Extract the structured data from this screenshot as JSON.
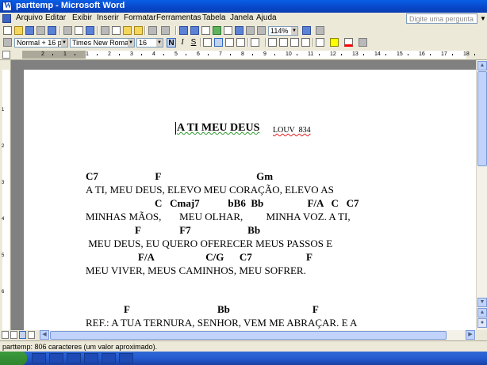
{
  "window": {
    "title": "parttemp - Microsoft Word"
  },
  "menubar": {
    "items": [
      "Arquivo",
      "Editar",
      "Exibir",
      "Inserir",
      "Formatar",
      "Ferramentas",
      "Tabela",
      "Janela",
      "Ajuda"
    ],
    "help_placeholder": "Digite uma pergunta"
  },
  "standard_toolbar": {
    "zoom": "114%"
  },
  "formatting_toolbar": {
    "style": "Normal + 16 pt, Neg",
    "font": "Times New Roman",
    "size": "16",
    "bold": "N",
    "italic": "I",
    "underline": "S"
  },
  "ruler": {
    "numbers": [
      "2",
      "1",
      "1",
      "2",
      "3",
      "4",
      "5",
      "6",
      "7",
      "8",
      "9",
      "10",
      "11",
      "12",
      "13",
      "14",
      "15",
      "16",
      "17",
      "18"
    ],
    "vertical_numbers": [
      "1",
      "2",
      "3",
      "4",
      "5",
      "6"
    ]
  },
  "document": {
    "title": "A TI MEU DEUS",
    "subtitle": "LOUV  834",
    "chords_1": "C7                      F                                     Gm",
    "lyrics_1": "A TI, MEU DEUS, ELEVO MEU CORAÇÃO, ELEVO AS",
    "chords_2": "C   Cmaj7           bB6  Bb                 F/A   C   C7",
    "lyrics_2": "MINHAS MÃOS,       MEU OLHAR,         MINHA VOZ. A TI,",
    "chords_3": "F               F7                      Bb",
    "lyrics_3": " MEU DEUS, EU QUERO OFERECER MEUS PASSOS E",
    "chords_4": "F/A                    C/G      C7                     F",
    "lyrics_4": "MEU VIVER, MEUS CAMINHOS, MEU SOFRER.",
    "chords_5": "F                                  Bb                                F",
    "lyrics_5": "REF.: A TUA TERNURA, SENHOR, VEM ME ABRAÇAR. E A"
  },
  "statusbar": {
    "text": "parttemp: 806 caracteres (um valor aproximado)."
  }
}
